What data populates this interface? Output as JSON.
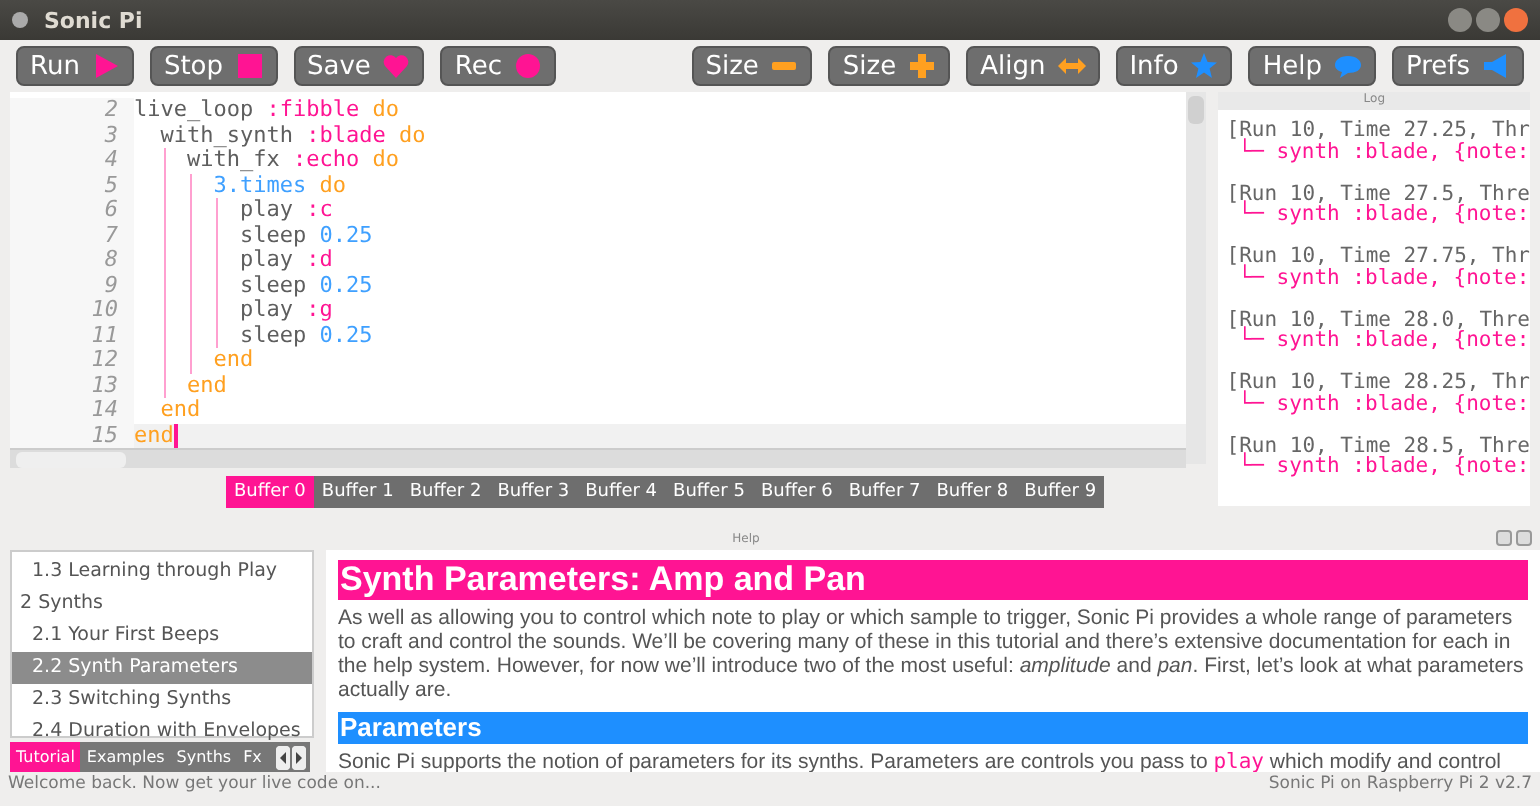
{
  "window": {
    "title": "Sonic Pi"
  },
  "toolbar": [
    {
      "label": "Run"
    },
    {
      "label": "Stop"
    },
    {
      "label": "Save"
    },
    {
      "label": "Rec"
    },
    {
      "label": "Size"
    },
    {
      "label": "Size"
    },
    {
      "label": "Align"
    },
    {
      "label": "Info"
    },
    {
      "label": "Help"
    },
    {
      "label": "Prefs"
    }
  ],
  "editor": {
    "lines": [
      {
        "number": "2",
        "current": false,
        "tokens": [
          {
            "text": "live_loop ",
            "kind": "plain"
          },
          {
            "text": ":fibble",
            "kind": "symbol"
          },
          {
            "text": " do",
            "kind": "keyword"
          }
        ]
      },
      {
        "number": "3",
        "current": false,
        "tokens": [
          {
            "text": "  with_synth ",
            "kind": "plain"
          },
          {
            "text": ":blade",
            "kind": "symbol"
          },
          {
            "text": " do",
            "kind": "keyword"
          }
        ]
      },
      {
        "number": "4",
        "current": false,
        "tokens": [
          {
            "text": "    with_fx ",
            "kind": "plain"
          },
          {
            "text": ":echo",
            "kind": "symbol"
          },
          {
            "text": " do",
            "kind": "keyword"
          }
        ]
      },
      {
        "number": "5",
        "current": false,
        "tokens": [
          {
            "text": "      3.times",
            "kind": "number"
          },
          {
            "text": " do",
            "kind": "keyword"
          }
        ]
      },
      {
        "number": "6",
        "current": false,
        "tokens": [
          {
            "text": "        play ",
            "kind": "plain"
          },
          {
            "text": ":c",
            "kind": "symbol"
          }
        ]
      },
      {
        "number": "7",
        "current": false,
        "tokens": [
          {
            "text": "        sleep ",
            "kind": "plain"
          },
          {
            "text": "0.25",
            "kind": "number"
          }
        ]
      },
      {
        "number": "8",
        "current": false,
        "tokens": [
          {
            "text": "        play ",
            "kind": "plain"
          },
          {
            "text": ":d",
            "kind": "symbol"
          }
        ]
      },
      {
        "number": "9",
        "current": false,
        "tokens": [
          {
            "text": "        sleep ",
            "kind": "plain"
          },
          {
            "text": "0.25",
            "kind": "number"
          }
        ]
      },
      {
        "number": "10",
        "current": false,
        "tokens": [
          {
            "text": "        play ",
            "kind": "plain"
          },
          {
            "text": ":g",
            "kind": "symbol"
          }
        ]
      },
      {
        "number": "11",
        "current": false,
        "tokens": [
          {
            "text": "        sleep ",
            "kind": "plain"
          },
          {
            "text": "0.25",
            "kind": "number"
          }
        ]
      },
      {
        "number": "12",
        "current": false,
        "tokens": [
          {
            "text": "      end",
            "kind": "keyword"
          }
        ]
      },
      {
        "number": "13",
        "current": false,
        "tokens": [
          {
            "text": "    end",
            "kind": "keyword"
          }
        ]
      },
      {
        "number": "14",
        "current": false,
        "tokens": [
          {
            "text": "  end",
            "kind": "keyword"
          }
        ]
      },
      {
        "number": "15",
        "current": true,
        "tokens": [
          {
            "text": "end",
            "kind": "keyword"
          }
        ]
      }
    ]
  },
  "buffers": [
    {
      "label": "Buffer 0",
      "selected": true
    },
    {
      "label": "Buffer 1",
      "selected": false
    },
    {
      "label": "Buffer 2",
      "selected": false
    },
    {
      "label": "Buffer 3",
      "selected": false
    },
    {
      "label": "Buffer 4",
      "selected": false
    },
    {
      "label": "Buffer 5",
      "selected": false
    },
    {
      "label": "Buffer 6",
      "selected": false
    },
    {
      "label": "Buffer 7",
      "selected": false
    },
    {
      "label": "Buffer 8",
      "selected": false
    },
    {
      "label": "Buffer 9",
      "selected": false
    }
  ],
  "log": {
    "title": "Log",
    "entries": [
      {
        "run": "[Run 10, Time 27.25, Thr",
        "synth": "└─ synth :blade, {note:"
      },
      {
        "run": "[Run 10, Time 27.5, Thre",
        "synth": "└─ synth :blade, {note:"
      },
      {
        "run": "[Run 10, Time 27.75, Thr",
        "synth": "└─ synth :blade, {note:"
      },
      {
        "run": "[Run 10, Time 28.0, Thre",
        "synth": "└─ synth :blade, {note:"
      },
      {
        "run": "[Run 10, Time 28.25, Thr",
        "synth": "└─ synth :blade, {note:"
      },
      {
        "run": "[Run 10, Time 28.5, Thre",
        "synth": "└─ synth :blade, {note:"
      }
    ]
  },
  "help": {
    "title": "Help",
    "toc": [
      {
        "children": [
          {
            "label": "1.3 Learning through Play",
            "selected": false
          }
        ]
      },
      {
        "label": "2 Synths",
        "selected": false,
        "children": [
          {
            "label": "2.1 Your First Beeps",
            "selected": false
          },
          {
            "label": "2.2 Synth Parameters",
            "selected": true
          },
          {
            "label": "2.3 Switching Synths",
            "selected": false
          },
          {
            "label": "2.4 Duration with Envelopes",
            "selected": false
          }
        ]
      }
    ],
    "tabs": [
      {
        "label": "Tutorial",
        "selected": true
      },
      {
        "label": "Examples",
        "selected": false
      },
      {
        "label": "Synths",
        "selected": false
      },
      {
        "label": "Fx",
        "selected": false
      }
    ],
    "article": {
      "heading": "Synth Parameters: Amp and Pan",
      "paragraph": "As well as allowing you to control which note to play or which sample to trigger, Sonic Pi provides a whole range of parameters to craft and control the sounds. We’ll be covering many of these in this tutorial and there’s extensive documentation for each in the help system. However, for now we’ll introduce two of the most useful: *amplitude* and *pan*. First, let’s look at what parameters actually are.",
      "subheading": "Parameters",
      "paragraph_2": [
        {
          "text": "Sonic Pi supports the notion of parameters for its synths. Parameters are controls you pass to ",
          "kind": "text"
        },
        {
          "text": "play",
          "kind": "code"
        },
        {
          "text": " which modify and control",
          "kind": "text"
        }
      ]
    }
  },
  "status_bar": {
    "message": "Welcome back. Now get your live code on...",
    "version": "Sonic Pi on Raspberry Pi 2 v2.7"
  }
}
